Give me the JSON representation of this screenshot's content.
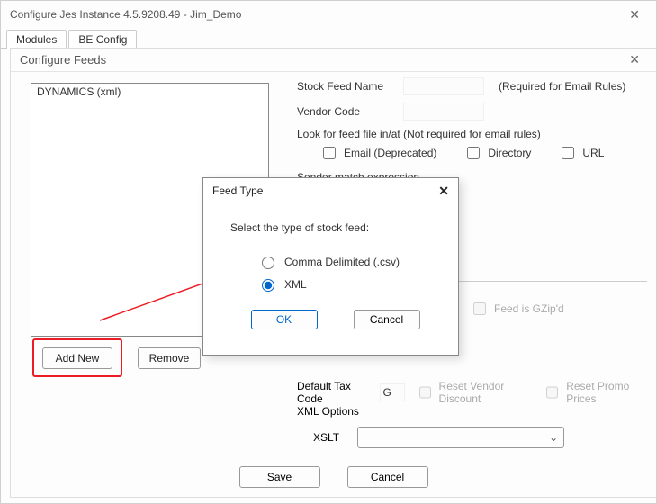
{
  "window": {
    "title": "Configure Jes Instance 4.5.9208.49 - Jim_Demo"
  },
  "tabs": {
    "modules": "Modules",
    "be_config": "BE Config"
  },
  "inner": {
    "title": "Configure Feeds"
  },
  "feeds_list": {
    "items": [
      "DYNAMICS (xml)"
    ]
  },
  "buttons": {
    "add_new": "Add New",
    "remove": "Remove",
    "save": "Save",
    "cancel": "Cancel",
    "ok": "OK"
  },
  "form": {
    "stock_feed_name_label": "Stock Feed Name",
    "stock_feed_name_hint": "(Required for Email Rules)",
    "vendor_code_label": "Vendor Code",
    "look_for_label": "Look for feed file in/at (Not required for email rules)",
    "cb_email": "Email (Deprecated)",
    "cb_directory": "Directory",
    "cb_url": "URL",
    "sender_match_label": "Sender match expression",
    "gzip_label": "Feed is GZip'd",
    "default_tax_label": "Default Tax Code",
    "default_tax_value": "G",
    "reset_vendor_label": "Reset Vendor Discount",
    "reset_promo_label": "Reset Promo Prices",
    "xml_options_label": "XML Options",
    "xslt_label": "XSLT"
  },
  "dialog": {
    "title": "Feed Type",
    "prompt": "Select the type of stock feed:",
    "opt_csv": "Comma Delimited (.csv)",
    "opt_xml": "XML"
  }
}
